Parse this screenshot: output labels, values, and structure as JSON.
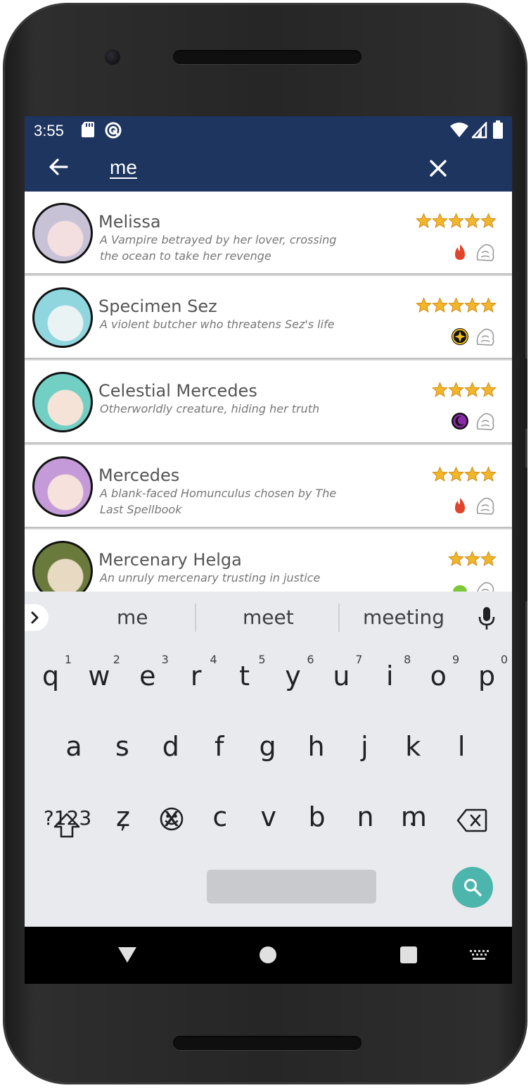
{
  "status_bar": {
    "time": "3:55"
  },
  "app_bar": {
    "search_query": "me"
  },
  "results": [
    {
      "name": "Melissa",
      "description": "A Vampire betrayed by her lover, crossing the ocean to take her revenge",
      "stars": 5,
      "element": "fire",
      "element_color": "#e0442a",
      "class_icon": "mage-class-icon",
      "avatar_colors": [
        "#c8c2d6",
        "#f3dfe0"
      ]
    },
    {
      "name": "Specimen Sez",
      "description": "A violent butcher who threatens Sez's life",
      "stars": 5,
      "element": "light",
      "element_color": "#f3c21c",
      "class_icon": "assassin-class-icon",
      "avatar_colors": [
        "#8fd6df",
        "#e9f3f4"
      ]
    },
    {
      "name": "Celestial Mercedes",
      "description": "Otherworldly creature, hiding her truth",
      "stars": 4,
      "element": "dark",
      "element_color": "#8a2aa8",
      "class_icon": "mage-class-icon",
      "avatar_colors": [
        "#72cfc3",
        "#f6e3d8"
      ]
    },
    {
      "name": "Mercedes",
      "description": "A blank-faced Homunculus chosen by The Last Spellbook",
      "stars": 4,
      "element": "fire",
      "element_color": "#e0442a",
      "class_icon": "mage-class-icon",
      "avatar_colors": [
        "#c49ad8",
        "#f6e1dc"
      ]
    },
    {
      "name": "Mercenary Helga",
      "description": "An unruly mercenary trusting in justice",
      "stars": 3,
      "element": "earth",
      "element_color": "#7cc83a",
      "class_icon": "ranger-class-icon",
      "avatar_colors": [
        "#6a7a3c",
        "#e8d9c2"
      ]
    }
  ],
  "suggestions": [
    "me",
    "meet",
    "meeting"
  ],
  "keyboard": {
    "row1": [
      {
        "key": "q",
        "hint": "1"
      },
      {
        "key": "w",
        "hint": "2"
      },
      {
        "key": "e",
        "hint": "3"
      },
      {
        "key": "r",
        "hint": "4"
      },
      {
        "key": "t",
        "hint": "5"
      },
      {
        "key": "y",
        "hint": "6"
      },
      {
        "key": "u",
        "hint": "7"
      },
      {
        "key": "i",
        "hint": "8"
      },
      {
        "key": "o",
        "hint": "9"
      },
      {
        "key": "p",
        "hint": "0"
      }
    ],
    "row2": [
      "a",
      "s",
      "d",
      "f",
      "g",
      "h",
      "j",
      "k",
      "l"
    ],
    "row3": [
      "z",
      "x",
      "c",
      "v",
      "b",
      "n",
      "m"
    ],
    "symbols_label": "?123",
    "comma": ",",
    "period": "."
  },
  "colors": {
    "app_bar": "#1d355f",
    "accent": "#4db6ac",
    "star": "#f4b52a"
  }
}
